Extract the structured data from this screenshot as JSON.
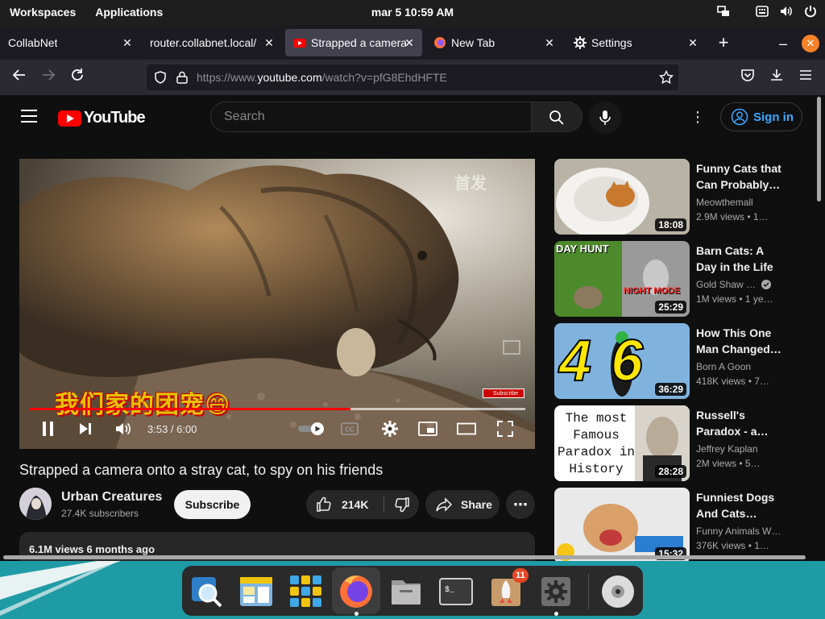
{
  "topbar": {
    "workspaces": "Workspaces",
    "applications": "Applications",
    "clock": "mar 5  10:59 AM"
  },
  "browser": {
    "tabs": [
      {
        "label": "CollabNet",
        "active": false
      },
      {
        "label": "router.collabnet.local/",
        "active": false
      },
      {
        "label": "Strapped a camera",
        "active": true
      },
      {
        "label": "New Tab",
        "active": false
      },
      {
        "label": "Settings",
        "active": false
      }
    ],
    "url": {
      "scheme": "https://www.",
      "host": "youtube.com",
      "path": "/watch?v=pfG8EhdHFTE"
    }
  },
  "youtube": {
    "logo": "YouTube",
    "search_placeholder": "Search",
    "signin": "Sign in",
    "player": {
      "subtitle": "我们家的团宠😄",
      "time": "3:53 / 6:00",
      "progress_fraction": 0.647,
      "watermark_subscribe": "Subscribe",
      "watermark_top": "首发"
    },
    "video": {
      "title": "Strapped a camera onto a stray cat, to spy on his friends",
      "channel": "Urban Creatures",
      "subscribers": "27.4K subscribers",
      "subscribe_label": "Subscribe",
      "likes": "214K",
      "share_label": "Share",
      "stats": "6.1M views  6 months ago"
    },
    "recommendations": [
      {
        "title": "Funny Cats that Can Probably…",
        "channel": "Meowthemall",
        "meta": "2.9M views  • 1…",
        "duration": "18:08",
        "verified": false
      },
      {
        "title": "Barn Cats: A Day in the Life",
        "channel": "Gold Shaw …",
        "meta": "1M views  • 1 ye…",
        "duration": "25:29",
        "verified": true,
        "thumb_text_1": "DAY HUNT",
        "thumb_text_2": "NIGHT MODE"
      },
      {
        "title": "How This One Man Changed…",
        "channel": "Born A Goon",
        "meta": "418K views  • 7…",
        "duration": "36:29",
        "verified": false,
        "thumb_text_1": "46"
      },
      {
        "title": "Russell's Paradox - a…",
        "channel": "Jeffrey Kaplan",
        "meta": "2M views  • 5…",
        "duration": "28:28",
        "verified": false,
        "thumb_text_1": "The most Famous Paradox in History"
      },
      {
        "title": "Funniest Dogs And Cats…",
        "channel": "Funny Animals W…",
        "meta": "376K views  • 1…",
        "duration": "15:32",
        "verified": false
      }
    ]
  },
  "dock": {
    "apps": [
      "search",
      "files-manager",
      "app-grid",
      "firefox",
      "files",
      "terminal",
      "software-updater",
      "settings",
      "disc"
    ],
    "updater_badge": "11"
  }
}
